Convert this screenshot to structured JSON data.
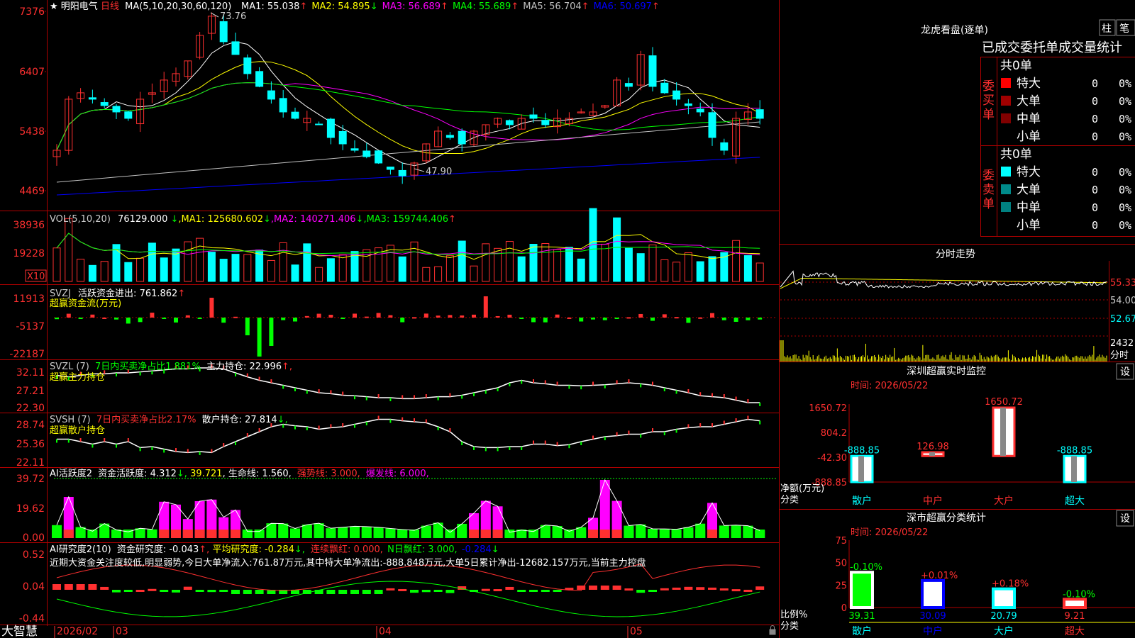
{
  "main": {
    "star": "★",
    "stock_name": "明阳电气",
    "period": "日线",
    "ma_label": "MA(5,10,20,30,60,120)",
    "ma": [
      {
        "name": "MA1",
        "value": "55.038",
        "arrow": "↑",
        "color": "#ffffff"
      },
      {
        "name": "MA2",
        "value": "54.895",
        "arrow": "↓",
        "color": "#ffff00"
      },
      {
        "name": "MA3",
        "value": "56.689",
        "arrow": "↑",
        "color": "#ff00ff"
      },
      {
        "name": "MA4",
        "value": "55.689",
        "arrow": "↑",
        "color": "#00ff00"
      },
      {
        "name": "MA5",
        "value": "56.704",
        "arrow": "↑",
        "color": "#c0c0c0"
      },
      {
        "name": "MA6",
        "value": "50.697",
        "arrow": "↑",
        "color": "#0000ff"
      }
    ],
    "price_ticks": [
      "7376",
      "6407",
      "5438",
      "4469"
    ],
    "high_label": "73.76",
    "low_label": "47.90"
  },
  "vol": {
    "title": "VOL(5,10,20)",
    "value": "76129.000",
    "value_arrow": "↓",
    "ma1": "125680.602",
    "ma1_arrow": "↓",
    "ma2": "140271.406",
    "ma2_arrow": "↓",
    "ma3": "159744.406",
    "ma3_arrow": "↑",
    "ticks": [
      "38936",
      "19228"
    ],
    "unit": "X10"
  },
  "svzj": {
    "title": "SVZJ",
    "label1": "活跃资金进出:",
    "value1": "761.862",
    "arrow1": "↑",
    "label2": "超赢资金流(万元)",
    "ticks": [
      "11913",
      "-5137",
      "-22187"
    ]
  },
  "svzl": {
    "title": "SVZL (7)",
    "label1": "7日内买卖净占比1.881%",
    "label2": "主力持仓:",
    "value2": "22.996",
    "arrow2": "↑,",
    "label3": "超赢主力持仓",
    "ticks": [
      "32.11",
      "27.21",
      "22.30"
    ]
  },
  "svsh": {
    "title": "SVSH (7)",
    "label1": "7日内买卖净占比2.17%",
    "label2": "散户持仓:",
    "value2": "27.814",
    "arrow2": "↓,",
    "label3": "超赢散户持仓",
    "ticks": [
      "28.74",
      "25.36",
      "22.11"
    ]
  },
  "ai1": {
    "title": "AI活跃度2",
    "label1": "资金活跃度:",
    "value1": "4.312",
    "arrow1": "↓,",
    "value2": "39.721",
    "label3": "生命线:",
    "value3": "1.560",
    "label4": "强势线: 3.000,",
    "label5": "爆发线: 6.000,",
    "ticks": [
      "39.72",
      "19.62",
      "0.00"
    ]
  },
  "ai2": {
    "title": "AI研究度2(10)",
    "label1": "资金研究度:",
    "value1": "-0.043",
    "arrow1": "↑,",
    "label2": "平均研究度: -0.284",
    "label3": "连续飘红: 0.000,",
    "label4": "N日飘红: 3.000,",
    "label5": "-0.284",
    "commentary": "近期大资金关注度较低,明显弱势,今日大单净流入:761.87万元,其中特大单净流出:-888.848万元,大单5日累计净出-12682.157万元,当前主力控盘",
    "ticks": [
      "0.52",
      "0.04",
      "-0.44"
    ]
  },
  "bottom": {
    "logo": "大智慧",
    "dates": [
      "2026/02",
      "03",
      "04",
      "05"
    ]
  },
  "dragon": {
    "title": "龙虎看盘(逐单)",
    "btn1": "柱",
    "btn2": "笔",
    "header": "已成交委托单成交量统计",
    "buy_label": "委买单",
    "sell_label": "委卖单",
    "buy_total": "共0单",
    "sell_total": "共0单",
    "buy_rows": [
      {
        "label": "特大",
        "count": "0",
        "pct": "0%",
        "color": "#ff0000"
      },
      {
        "label": "大单",
        "count": "0",
        "pct": "0%",
        "color": "#a00000"
      },
      {
        "label": "中单",
        "count": "0",
        "pct": "0%",
        "color": "#800000"
      },
      {
        "label": "小单",
        "count": "0",
        "pct": "0%",
        "color": ""
      }
    ],
    "sell_rows": [
      {
        "label": "特大",
        "count": "0",
        "pct": "0%",
        "color": "#00ffff"
      },
      {
        "label": "大单",
        "count": "0",
        "pct": "0%",
        "color": "#008b8b"
      },
      {
        "label": "中单",
        "count": "0",
        "pct": "0%",
        "color": "#008080"
      },
      {
        "label": "小单",
        "count": "0",
        "pct": "0%",
        "color": ""
      }
    ]
  },
  "intraday": {
    "title": "分时走势",
    "ticks": [
      "55.33",
      "54.00",
      "52.67"
    ],
    "vol_tick": "2432",
    "vol_unit": "分时"
  },
  "monitor": {
    "title": "深圳超赢实时监控",
    "settings": "设",
    "time": "时间: 2026/05/22",
    "ticks": [
      "1650.72",
      "804.2",
      "-42.30",
      "-888.85"
    ],
    "ylabel1": "净额(万元)",
    "ylabel2": "分类",
    "chart_data": {
      "type": "bar",
      "categories": [
        "散户",
        "中户",
        "大户",
        "超大"
      ],
      "values": [
        -888.85,
        126.98,
        1650.72,
        -888.85
      ],
      "ylim": [
        -888.85,
        1650.72
      ]
    }
  },
  "classify": {
    "title": "深市超赢分类统计",
    "settings": "设",
    "time": "时间: 2026/05/22",
    "ticks": [
      "75",
      "50",
      "25",
      "0"
    ],
    "ylabel1": "比例%",
    "ylabel2": "分类",
    "chart_data": {
      "type": "bar",
      "categories": [
        "散户",
        "中户",
        "大户",
        "超大"
      ],
      "values": [
        39.31,
        30.09,
        20.79,
        9.21
      ],
      "changes": [
        "-0.10%",
        "+0.01%",
        "+0.18%",
        "-0.10%"
      ],
      "ylim": [
        0,
        75
      ]
    }
  },
  "colors": {
    "up": "#ff3030",
    "down": "#00ffff",
    "grid": "#b00000",
    "axis_text": "#ff3030"
  }
}
